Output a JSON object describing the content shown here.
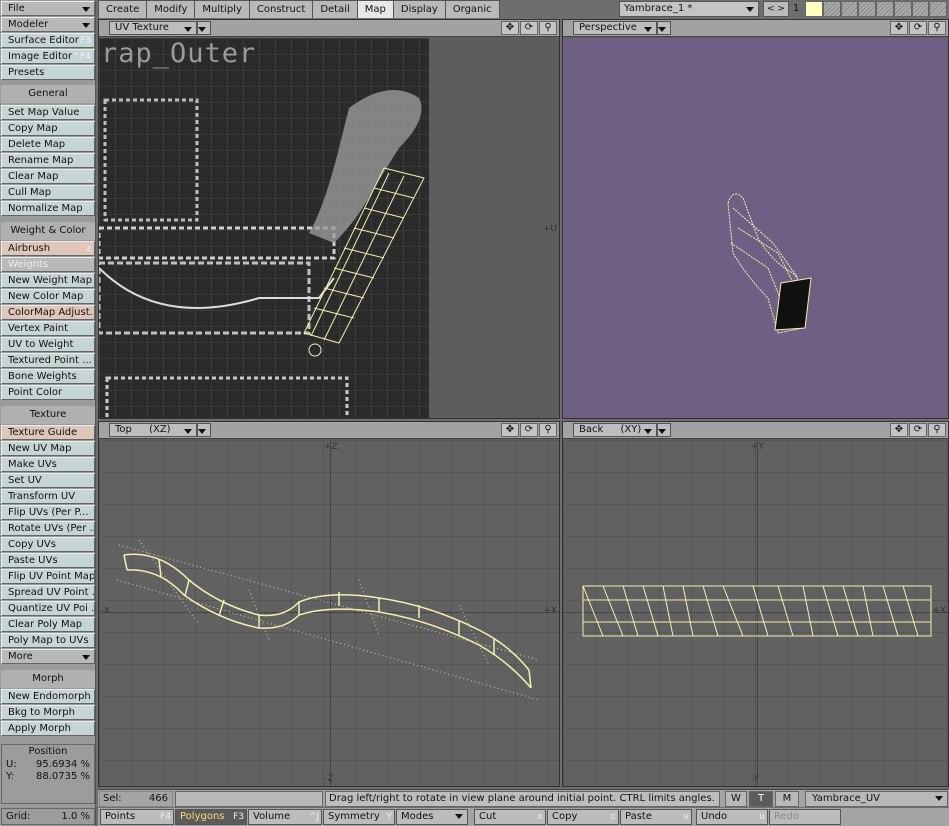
{
  "sidebar": {
    "file": "File",
    "modeler": "Modeler",
    "items_top": [
      {
        "label": "Surface Editor",
        "key": "F3"
      },
      {
        "label": "Image Editor",
        "key": "^F4"
      },
      {
        "label": "Presets",
        "key": ""
      }
    ],
    "sec_general": "General",
    "general": [
      {
        "label": "Set Map Value",
        "key": ""
      },
      {
        "label": "Copy Map",
        "key": ""
      },
      {
        "label": "Delete Map",
        "key": ""
      },
      {
        "label": "Rename Map",
        "key": ""
      },
      {
        "label": "Clear Map",
        "key": "_"
      },
      {
        "label": "Cull Map",
        "key": ""
      },
      {
        "label": "Normalize Map",
        "key": ""
      }
    ],
    "sec_weight": "Weight & Color",
    "weight": [
      {
        "label": "Airbrush",
        "key": "z"
      },
      {
        "label": "Weights",
        "key": ""
      },
      {
        "label": "New Weight Map",
        "key": ""
      },
      {
        "label": "New Color Map",
        "key": ""
      },
      {
        "label": "ColorMap Adjust...",
        "key": ""
      },
      {
        "label": "Vertex Paint",
        "key": ""
      },
      {
        "label": "UV to Weight",
        "key": ""
      },
      {
        "label": "Textured Point ...",
        "key": ""
      },
      {
        "label": "Bone Weights",
        "key": ""
      },
      {
        "label": "Point Color",
        "key": ""
      }
    ],
    "sec_texture": "Texture",
    "texture": [
      {
        "label": "Texture Guide",
        "key": ""
      },
      {
        "label": "New UV Map",
        "key": ""
      },
      {
        "label": "Make UVs",
        "key": ""
      },
      {
        "label": "Set UV",
        "key": ""
      },
      {
        "label": "Transform UV",
        "key": ""
      },
      {
        "label": "Flip UVs (Per P...",
        "key": ""
      },
      {
        "label": "Rotate UVs (Per ...",
        "key": ""
      },
      {
        "label": "Copy UVs",
        "key": ""
      },
      {
        "label": "Paste UVs",
        "key": ""
      },
      {
        "label": "Flip UV Point Map",
        "key": ""
      },
      {
        "label": "Spread UV Point ...",
        "key": ""
      },
      {
        "label": "Quantize UV Poi ...",
        "key": ""
      },
      {
        "label": "Clear Poly Map",
        "key": ""
      },
      {
        "label": "Poly Map to UVs",
        "key": ""
      }
    ],
    "more": "More",
    "sec_morph": "Morph",
    "morph": [
      {
        "label": "New Endomorph",
        "key": ""
      },
      {
        "label": "Bkg to Morph",
        "key": ""
      },
      {
        "label": "Apply Morph",
        "key": ""
      }
    ],
    "position": {
      "title": "Position",
      "u_label": "U:",
      "u": "95.6934 %",
      "v_label": "Y:",
      "v": "88.0735 %"
    },
    "grid_label": "Grid:",
    "grid_value": "1.0 %"
  },
  "tabs": [
    "Create",
    "Modify",
    "Multiply",
    "Construct",
    "Detail",
    "Map",
    "Display",
    "Organic"
  ],
  "active_tab": "Map",
  "object": "Yambrace_1 *",
  "layer_arrows": "< >",
  "layer_num": "1",
  "viewports": {
    "uv": {
      "label": "UV Texture",
      "axis_u": "+U"
    },
    "persp": {
      "label": "Perspective"
    },
    "top": {
      "label": "Top",
      "axes": "(XZ)",
      "x_pos": "+X",
      "x_neg": "-X",
      "z_pos": "+Z",
      "z_neg": "-Z"
    },
    "back": {
      "label": "Back",
      "axes": "(XY)",
      "x_pos": "+X",
      "y_pos": "+Y",
      "y_neg": "-Y"
    }
  },
  "uv_texture_text": "rap_Outer",
  "status": {
    "sel_label": "Sel:",
    "sel_value": "466",
    "message": "Drag left/right to rotate in view plane around initial point. CTRL limits angles.",
    "w": "W",
    "t": "T",
    "m": "M",
    "map": "Yambrace_UV"
  },
  "bottom": [
    {
      "label": "Points",
      "key": "F4"
    },
    {
      "label": "Polygons",
      "key": "F3"
    },
    {
      "label": "Volume",
      "key": "^J"
    },
    {
      "label": "Symmetry",
      "key": "Y"
    },
    {
      "label": "Modes",
      "key": ""
    },
    {
      "label": "Cut",
      "key": "x"
    },
    {
      "label": "Copy",
      "key": "c"
    },
    {
      "label": "Paste",
      "key": "v"
    },
    {
      "label": "Undo",
      "key": "u"
    },
    {
      "label": "Redo",
      "key": ""
    }
  ],
  "colors": {
    "persp_bg": "#6f5f84",
    "wire": "#f4f0b0",
    "selected_tab": "#e8e8e8"
  }
}
